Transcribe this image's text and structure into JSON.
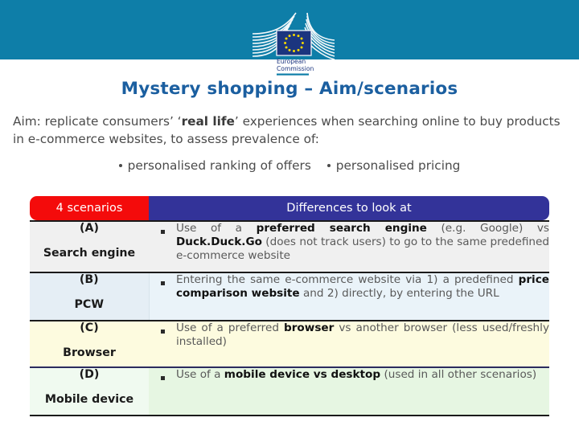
{
  "header": {
    "banner_color": "#0e7ea8",
    "logo": {
      "icon": "european-commission-logo",
      "line1": "European",
      "line2": "Commission",
      "flag_bg": "#1b357f",
      "star_color": "#f5d800"
    }
  },
  "title": {
    "text": "Mystery shopping – Aim/scenarios",
    "color": "#1b5fa0"
  },
  "aim": {
    "prefix": "Aim: replicate consumers’ ‘",
    "bold": "real life",
    "suffix": "’ experiences when searching online to buy products in e-commerce websites, to assess prevalence of:",
    "bullets": [
      "personalised ranking of offers",
      "personalised pricing"
    ]
  },
  "table": {
    "header": {
      "left": "4 scenarios",
      "right": "Differences to look at",
      "left_color": "#f40b0b",
      "right_color": "#333399"
    },
    "rows": [
      {
        "code": "(A)",
        "name": "Search engine",
        "bullet": "square-bullet",
        "text_parts": [
          {
            "t": "Use of a ",
            "b": false
          },
          {
            "t": "preferred search engine",
            "b": true
          },
          {
            "t": " (e.g. Google) vs ",
            "b": false
          },
          {
            "t": "Duck.Duck.Go",
            "b": true
          },
          {
            "t": " (does not track users) to go to the same predefined e-commerce website",
            "b": false
          }
        ],
        "bg": "#f0f0f0"
      },
      {
        "code": "(B)",
        "name": "PCW",
        "bullet": "square-bullet",
        "text_parts": [
          {
            "t": "Entering the same e-commerce website via 1) a predefined ",
            "b": false
          },
          {
            "t": "price comparison website",
            "b": true
          },
          {
            "t": " and 2) directly, by entering the URL",
            "b": false
          }
        ],
        "bg": "#eaf3f9"
      },
      {
        "code": "(C)",
        "name": "Browser",
        "bullet": "square-bullet",
        "text_parts": [
          {
            "t": "Use of a preferred ",
            "b": false
          },
          {
            "t": "browser",
            "b": true
          },
          {
            "t": " vs another browser (less used/freshly installed)",
            "b": false
          }
        ],
        "bg": "#fdfbdf"
      },
      {
        "code": "(D)",
        "name": "Mobile device",
        "bullet": "square-bullet",
        "text_parts": [
          {
            "t": "Use of a ",
            "b": false
          },
          {
            "t": "mobile device vs desktop",
            "b": true
          },
          {
            "t": " (used in all other scenarios)",
            "b": false
          }
        ],
        "bg": "#e6f6e2"
      }
    ]
  }
}
